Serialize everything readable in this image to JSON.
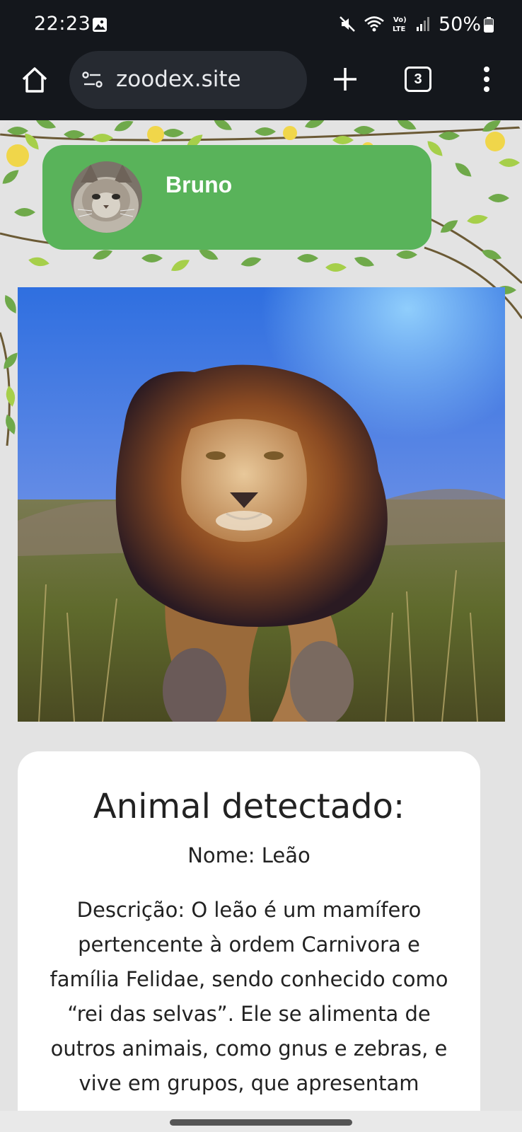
{
  "status_bar": {
    "time": "22:23",
    "battery": "50%",
    "icons": [
      "gallery-icon",
      "mute-icon",
      "wifi-icon",
      "volte-icon",
      "signal-icon",
      "battery-icon"
    ]
  },
  "browser": {
    "url": "zoodex.site",
    "tab_count": "3",
    "icons": [
      "home-icon",
      "site-info-icon",
      "plus-icon",
      "tabs-icon",
      "more-vert-icon"
    ]
  },
  "user": {
    "name": "Bruno",
    "card_color": "#59b35a"
  },
  "detection": {
    "title": "Animal detectado:",
    "name": "Nome: Leão",
    "description": "Descrição: O leão é um mamífero pertencente à ordem Carnivora e família Felidae, sendo conhecido como “rei das selvas”. Ele se alimenta de outros animais, como gnus e zebras, e vive em grupos, que apresentam"
  },
  "colors": {
    "browser_bg": "#14171c",
    "url_pill": "#262a31",
    "page_bg": "#e3e3e3"
  }
}
